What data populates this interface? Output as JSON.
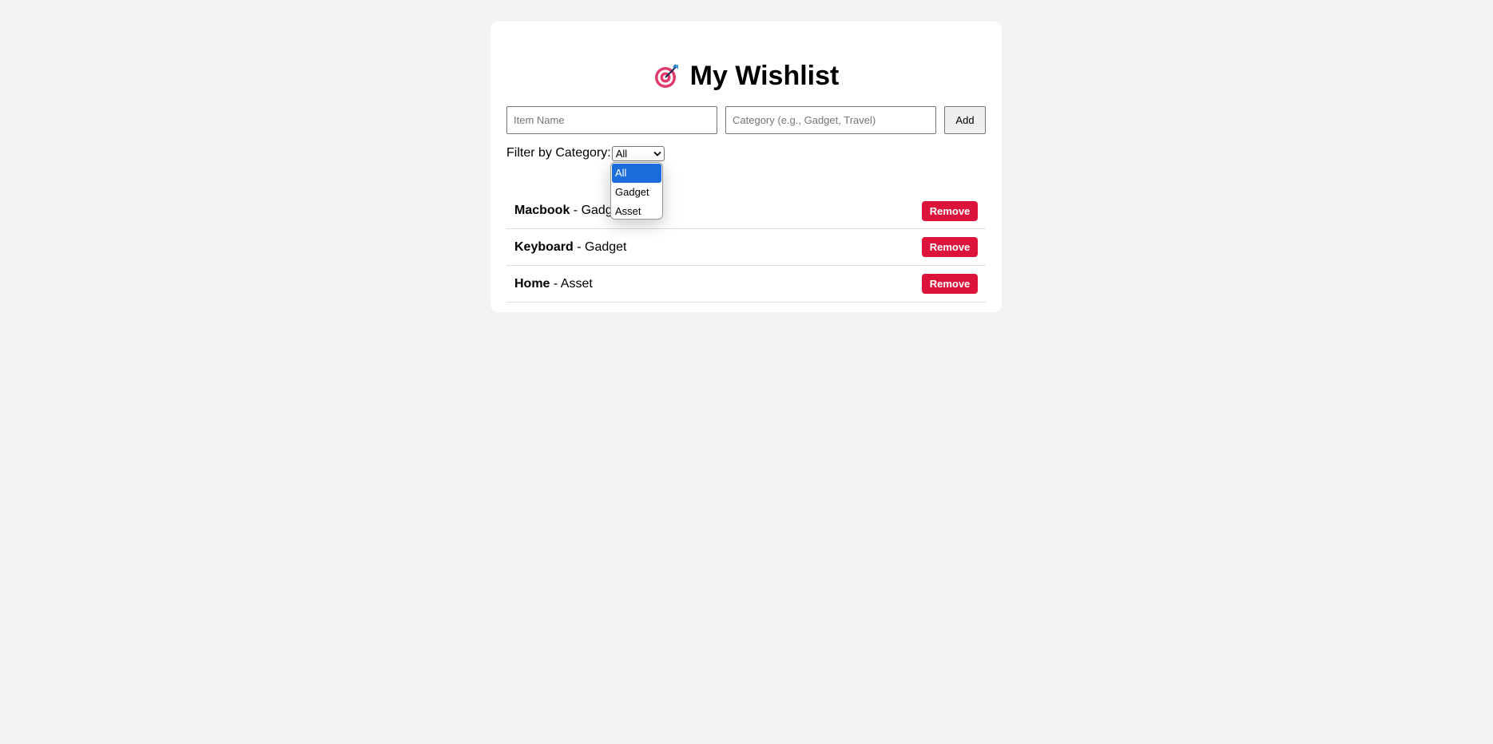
{
  "header": {
    "icon": "target-dart-icon",
    "title": "My Wishlist"
  },
  "form": {
    "item_name_placeholder": "Item Name",
    "item_name_value": "",
    "category_placeholder": "Category (e.g., Gadget, Travel)",
    "category_value": "",
    "add_label": "Add"
  },
  "filter": {
    "label": "Filter by Category:",
    "selected": "All",
    "options": [
      "All",
      "Gadget",
      "Asset"
    ]
  },
  "items": [
    {
      "name": "Macbook",
      "separator": " - ",
      "category": "Gadget",
      "remove_label": "Remove"
    },
    {
      "name": "Keyboard",
      "separator": " - ",
      "category": "Gadget",
      "remove_label": "Remove"
    },
    {
      "name": "Home",
      "separator": " - ",
      "category": "Asset",
      "remove_label": "Remove"
    }
  ],
  "colors": {
    "page_background": "#f3f3f3",
    "card_background": "#ffffff",
    "remove_button": "#dc143c",
    "dropdown_highlight": "#1a6ddb"
  }
}
